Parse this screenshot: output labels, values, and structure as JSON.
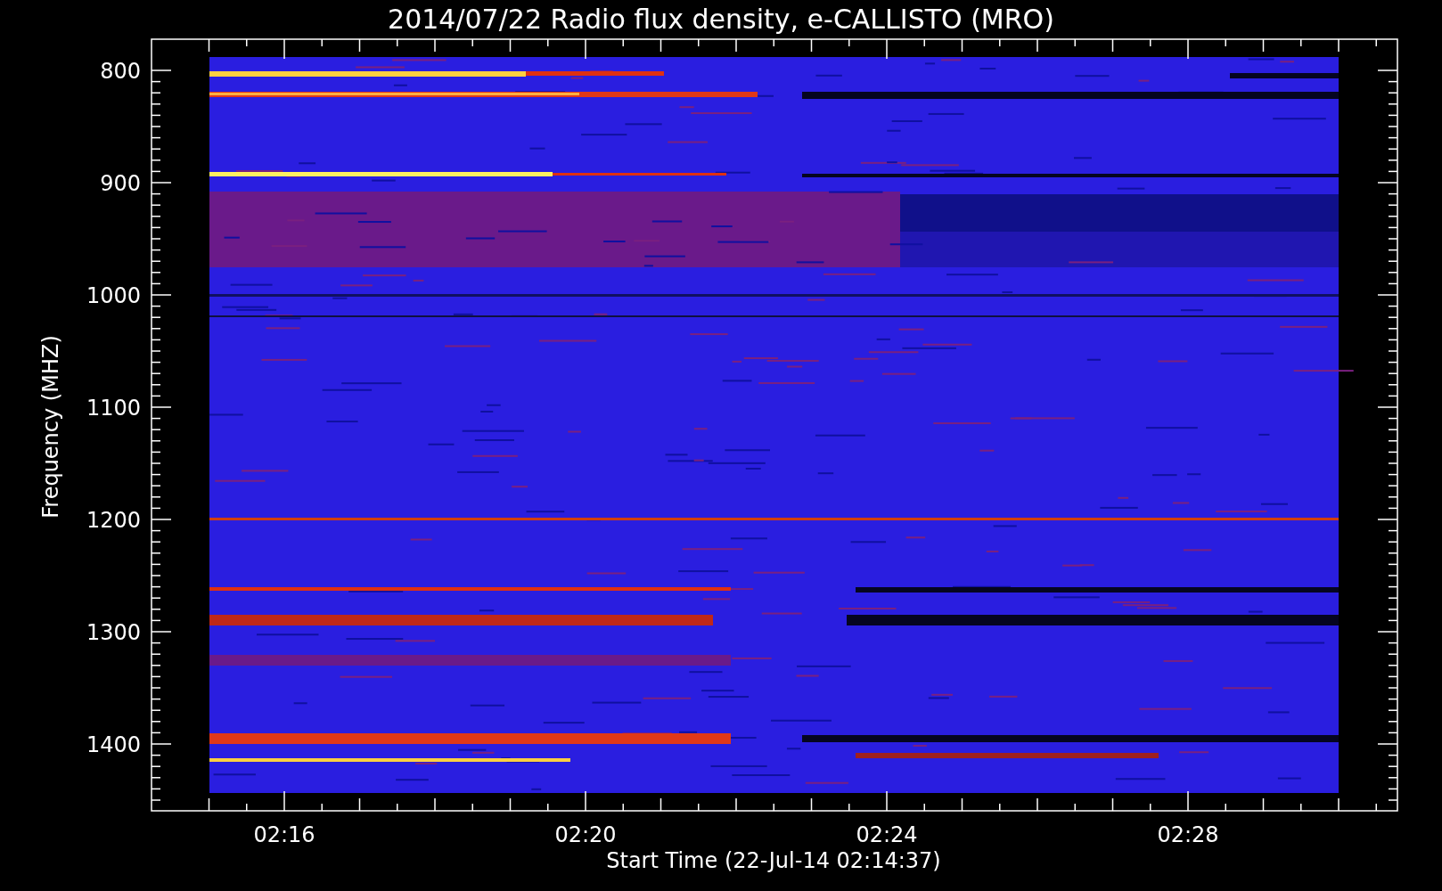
{
  "title": "2014/07/22  Radio flux density, e-CALLISTO (MRO)",
  "y_axis": {
    "label": "Frequency (MHZ)",
    "ticks": [
      "800",
      "900",
      "1000",
      "1100",
      "1200",
      "1300",
      "1400"
    ]
  },
  "x_axis": {
    "label": "Start Time (22-Jul-14 02:14:37)",
    "ticks": [
      "02:16",
      "02:20",
      "02:24",
      "02:28"
    ]
  }
}
